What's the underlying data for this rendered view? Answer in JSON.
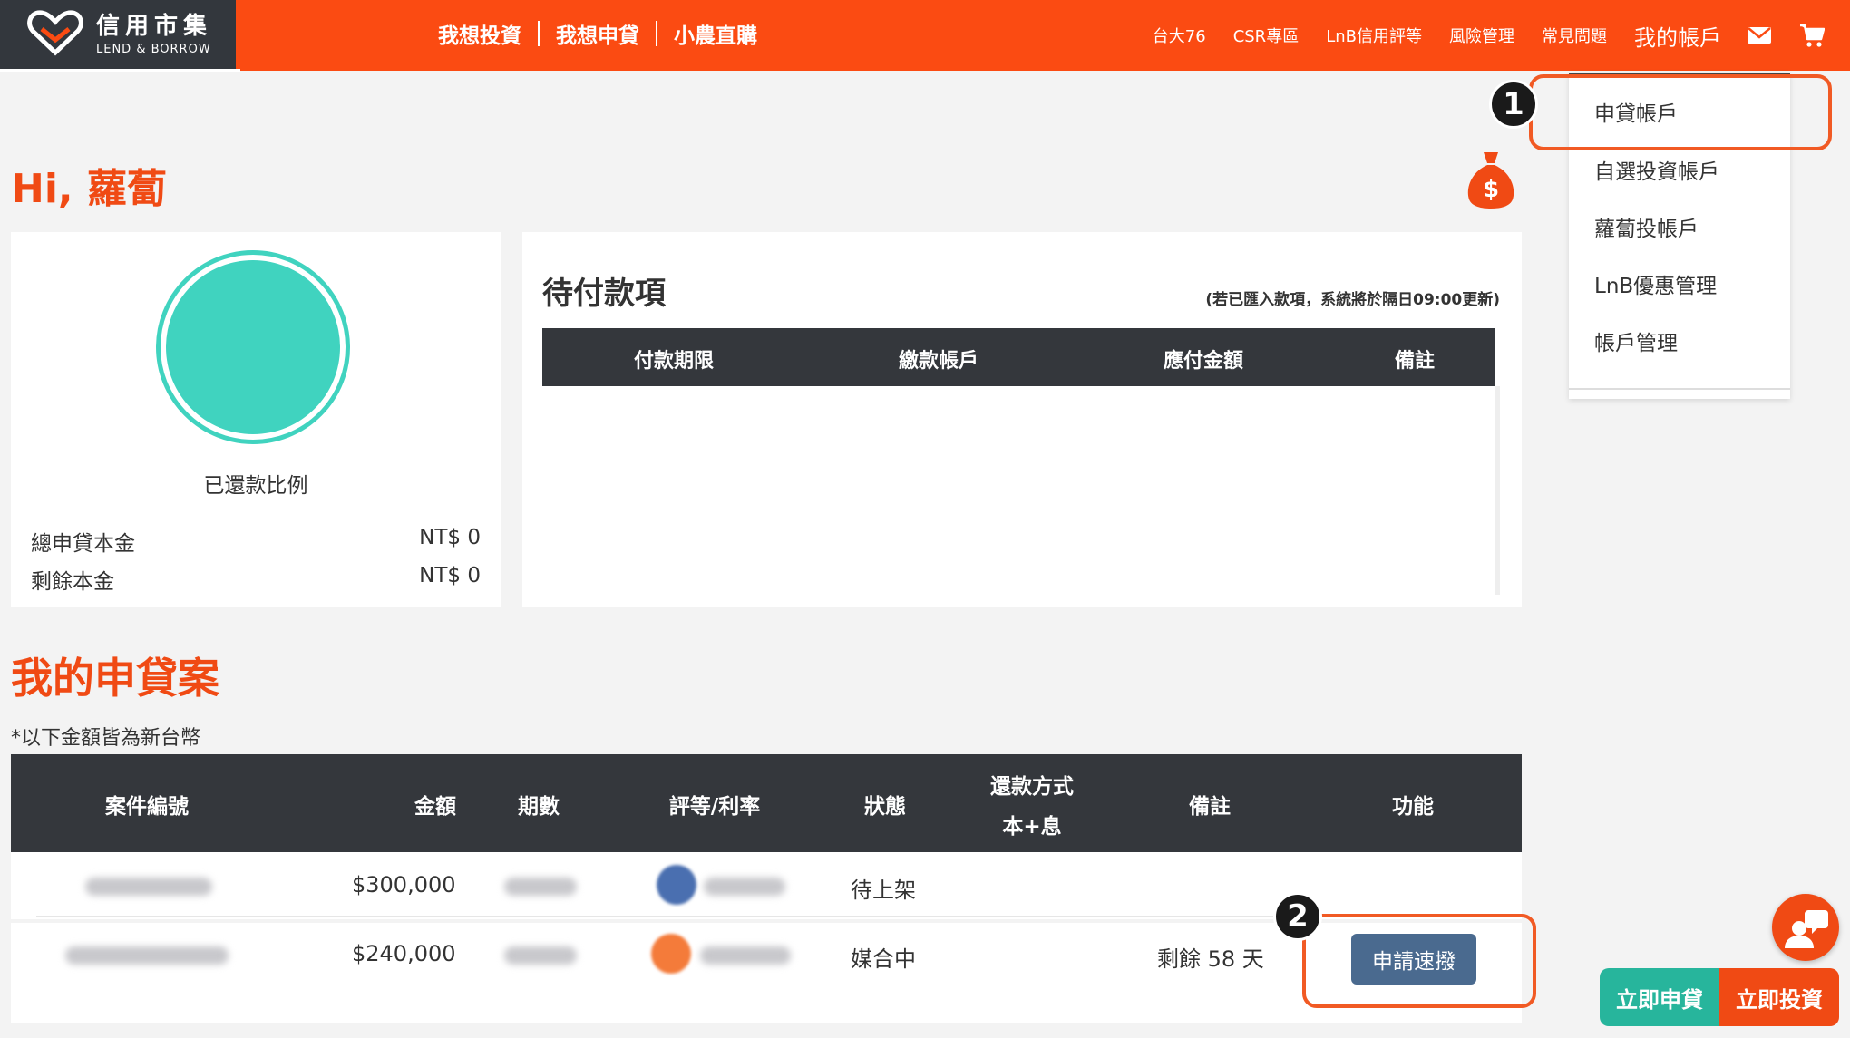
{
  "header": {
    "logo_cn": "信用市集",
    "logo_en": "LEND & BORROW",
    "main_nav": [
      "我想投資",
      "我想申貸",
      "小農直購"
    ],
    "right_nav": [
      "台大76",
      "CSR專區",
      "LnB信用評等",
      "風險管理",
      "常見問題"
    ],
    "my_account": "我的帳戶"
  },
  "dropdown": {
    "items": [
      "申貸帳戶",
      "自選投資帳戶",
      "蘿蔔投帳戶",
      "LnB優惠管理",
      "帳戶管理"
    ]
  },
  "callouts": [
    "1",
    "2"
  ],
  "greeting": "Hi, 蘿蔔",
  "summary": {
    "ring_label": "已還款比例",
    "repaid_fraction": 0,
    "rows": [
      {
        "label": "總申貸本金",
        "value": "NT$ 0"
      },
      {
        "label": "剩餘本金",
        "value": "NT$ 0"
      }
    ]
  },
  "payments": {
    "title": "待付款項",
    "note": "(若已匯入款項，系統將於隔日09:00更新)",
    "columns": [
      "付款期限",
      "繳款帳戶",
      "應付金額",
      "備註"
    ]
  },
  "loans": {
    "title": "我的申貸案",
    "note": "*以下金額皆為新台幣",
    "columns": [
      "案件編號",
      "金額",
      "期數",
      "評等/利率",
      "狀態",
      "還款方式",
      "本+息",
      "備註",
      "功能"
    ],
    "rows": [
      {
        "amount": "$300,000",
        "status": "待上架",
        "remark": "",
        "grade_color": "#4a6fb0"
      },
      {
        "amount": "$240,000",
        "status": "媒合中",
        "remark": "剩餘 58 天",
        "grade_color": "#f47b3a"
      }
    ],
    "action_label": "申請速撥"
  },
  "floating": {
    "loan_now": "立即申貸",
    "invest_now": "立即投資"
  },
  "colors": {
    "brand_orange": "#fb4b12",
    "dark": "#34373c",
    "teal": "#40d3bf",
    "button_blue": "#4a6a8f",
    "callout": "#f15a24"
  }
}
